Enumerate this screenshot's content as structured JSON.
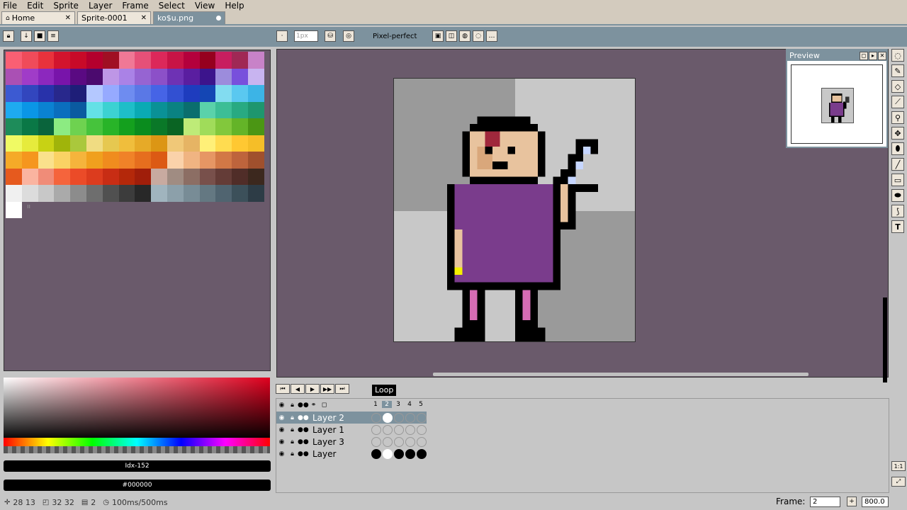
{
  "menu": [
    "File",
    "Edit",
    "Sprite",
    "Layer",
    "Frame",
    "Select",
    "View",
    "Help"
  ],
  "tabs": [
    {
      "label": "Home",
      "close": "✕"
    },
    {
      "label": "Sprite-0001",
      "close": "✕"
    },
    {
      "label": "ko$u.png"
    }
  ],
  "toolbar": {
    "brush_size": "1px",
    "pixel_perfect": "Pixel-perfect"
  },
  "palette": {
    "colors": [
      "#fa5f73",
      "#f04b5a",
      "#e8323c",
      "#d2142d",
      "#c80a28",
      "#b4002d",
      "#a00f23",
      "#f07896",
      "#e65078",
      "#dc285a",
      "#c81446",
      "#b4003c",
      "#96001e",
      "#c81e5f",
      "#a02855",
      "#c882c8",
      "#aa50b4",
      "#a03cc8",
      "#8c28be",
      "#7814aa",
      "#5a0a82",
      "#4b0a6e",
      "#be96e6",
      "#aa82e6",
      "#9664d2",
      "#8c50c8",
      "#6e32b4",
      "#5a1ea0",
      "#3c148c",
      "#9c8cdc",
      "#7850dc",
      "#c8b4f0",
      "#3c5ad2",
      "#3246be",
      "#2832aa",
      "#28288c",
      "#1e1e78",
      "#b4c8ff",
      "#96aaff",
      "#6e8cf0",
      "#5a78e6",
      "#4664e6",
      "#3250d2",
      "#1e3cbe",
      "#1446b4",
      "#82dcf0",
      "#5ac8f0",
      "#3cb4e6",
      "#1eaaf0",
      "#0a96e6",
      "#0a82d2",
      "#0a6ebe",
      "#0a5aa0",
      "#64e1e6",
      "#3cd2d2",
      "#1ebec8",
      "#0aaab4",
      "#0a9196",
      "#0a8282",
      "#0a6e6e",
      "#5ad2aa",
      "#3cbe96",
      "#28aa82",
      "#1e966e",
      "#1e8c5a",
      "#0a7846",
      "#0a643c",
      "#8ceb82",
      "#6ed250",
      "#46c33c",
      "#28b428",
      "#14a01e",
      "#0a8c1e",
      "#0a7828",
      "#0a6423",
      "#beeb78",
      "#a0dc5a",
      "#82c83c",
      "#64b428",
      "#4b9614",
      "#f0fa64",
      "#e6eb3c",
      "#c8d214",
      "#a0b40a",
      "#aac83c",
      "#f0dc82",
      "#e6c850",
      "#f0be3c",
      "#e6aa28",
      "#dc9614",
      "#f0c878",
      "#e6b464",
      "#fff078",
      "#ffdc50",
      "#ffc832",
      "#f5be28",
      "#f5aa28",
      "#f5961e",
      "#fae18c",
      "#fad264",
      "#f5b43c",
      "#f0a01e",
      "#f08c1e",
      "#f08228",
      "#e66e1e",
      "#dc5a14",
      "#fad2aa",
      "#f0b482",
      "#e69664",
      "#d27846",
      "#be643c",
      "#a0502d",
      "#e65a1e",
      "#fab4a0",
      "#f08c78",
      "#f5643c",
      "#eb4b28",
      "#dc3c1e",
      "#c82d14",
      "#b4280a",
      "#a01e0a",
      "#c8aaa0",
      "#a08c82",
      "#8c6e64",
      "#78504b",
      "#643c37",
      "#502d28",
      "#3c281e",
      "#f0f0f0",
      "#dcdcdc",
      "#c8c8c8",
      "#aaaaaa",
      "#8c8c8c",
      "#6e6e6e",
      "#505050",
      "#3c3c3c",
      "#282828",
      "#a0b4be",
      "#8ca0aa",
      "#788c96",
      "#647882",
      "#506470",
      "#3c505a",
      "#2d3c46",
      "#ffffff"
    ],
    "index_label": "Idx-152",
    "hex_label": "#000000"
  },
  "preview": {
    "title": "Preview"
  },
  "timeline": {
    "loop_label": "Loop",
    "frames": [
      "1",
      "2",
      "3",
      "4",
      "5"
    ],
    "layers": [
      "Layer 2",
      "Layer 1",
      "Layer 3",
      "Layer"
    ]
  },
  "status": {
    "pos": "28 13",
    "size": "32 32",
    "frame": "2",
    "duration": "100ms/500ms",
    "frame_label": "Frame:",
    "frame_value": "2",
    "zoom": "800.0"
  }
}
